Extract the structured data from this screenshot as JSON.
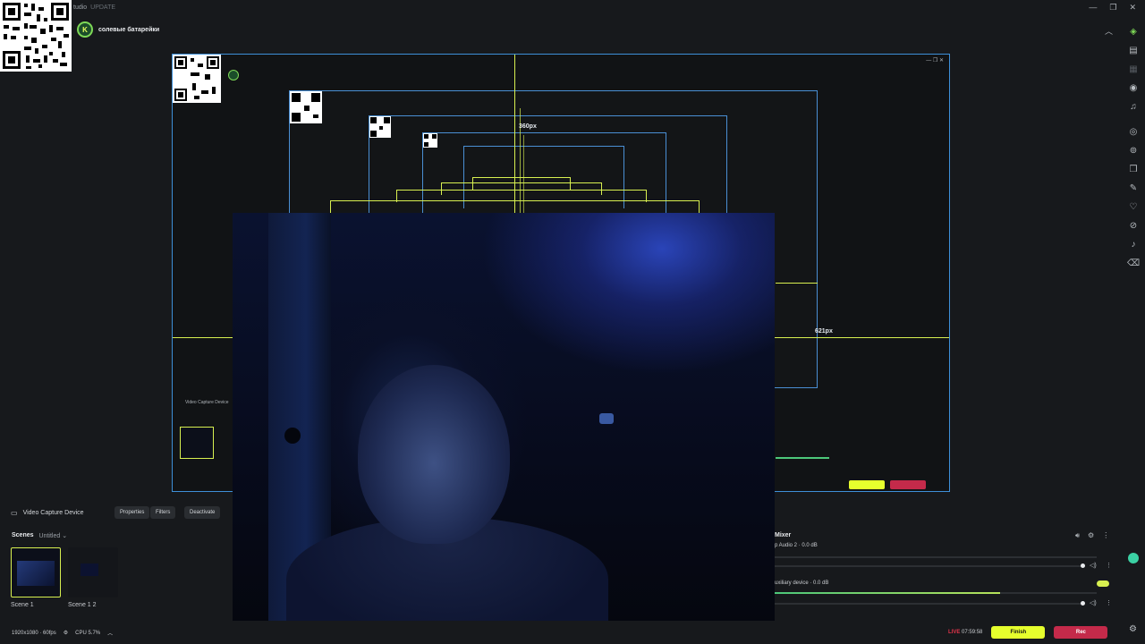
{
  "titlebar": {
    "app_name": "tudio",
    "update_label": "UPDATE"
  },
  "header": {
    "channel_name": "солевые батарейки"
  },
  "preview": {
    "label_top": "360px",
    "label_right": "621px",
    "source_panel_label": "Video Capture Device"
  },
  "source": {
    "name": "Video Capture Device",
    "properties_label": "Properties",
    "filters_label": "Filters",
    "deactivate_label": "Deactivate"
  },
  "scenes": {
    "title": "Scenes",
    "collection": "Untitled",
    "items": [
      {
        "name": "Scene 1"
      },
      {
        "name": "Scene 1 2"
      }
    ]
  },
  "mixer": {
    "title": "Mixer",
    "channels": [
      {
        "name": "p Audio 2 · 0.0 dB",
        "level": 0
      },
      {
        "name": "uxiliary device · 0.0 dB",
        "level": 0.7
      }
    ]
  },
  "status": {
    "resolution": "1920x1080",
    "fps": "60fps",
    "cpu": "CPU 5.7%",
    "live_label": "LIVE",
    "timer": "07:59:58",
    "finish_label": "Finish",
    "rec_label": "Rec"
  },
  "colors": {
    "accent": "#e6ff2d",
    "rec": "#c42a4a",
    "guide": "#d8f050",
    "border": "#3e8fd8"
  }
}
